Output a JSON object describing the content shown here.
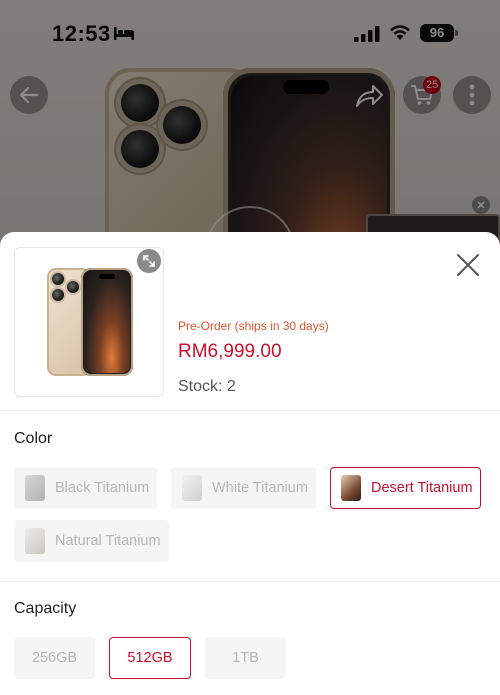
{
  "status_bar": {
    "time": "12:53",
    "battery": "96"
  },
  "background": {
    "cart_count": "25"
  },
  "sheet": {
    "preorder_text": "Pre-Order (ships in 30 days)",
    "price": "RM6,999.00",
    "stock": "Stock: 2",
    "color_title": "Color",
    "colors": [
      {
        "label": "Black Titanium",
        "selected": false
      },
      {
        "label": "White Titanium",
        "selected": false
      },
      {
        "label": "Desert Titanium",
        "selected": true
      },
      {
        "label": "Natural Titanium",
        "selected": false
      }
    ],
    "capacity_title": "Capacity",
    "capacities": [
      {
        "label": "256GB",
        "selected": false
      },
      {
        "label": "512GB",
        "selected": true
      },
      {
        "label": "1TB",
        "selected": false
      }
    ]
  },
  "colors": {
    "accent_red": "#c8102e",
    "preorder_orange": "#e0542b",
    "badge_red": "#d0021b"
  }
}
